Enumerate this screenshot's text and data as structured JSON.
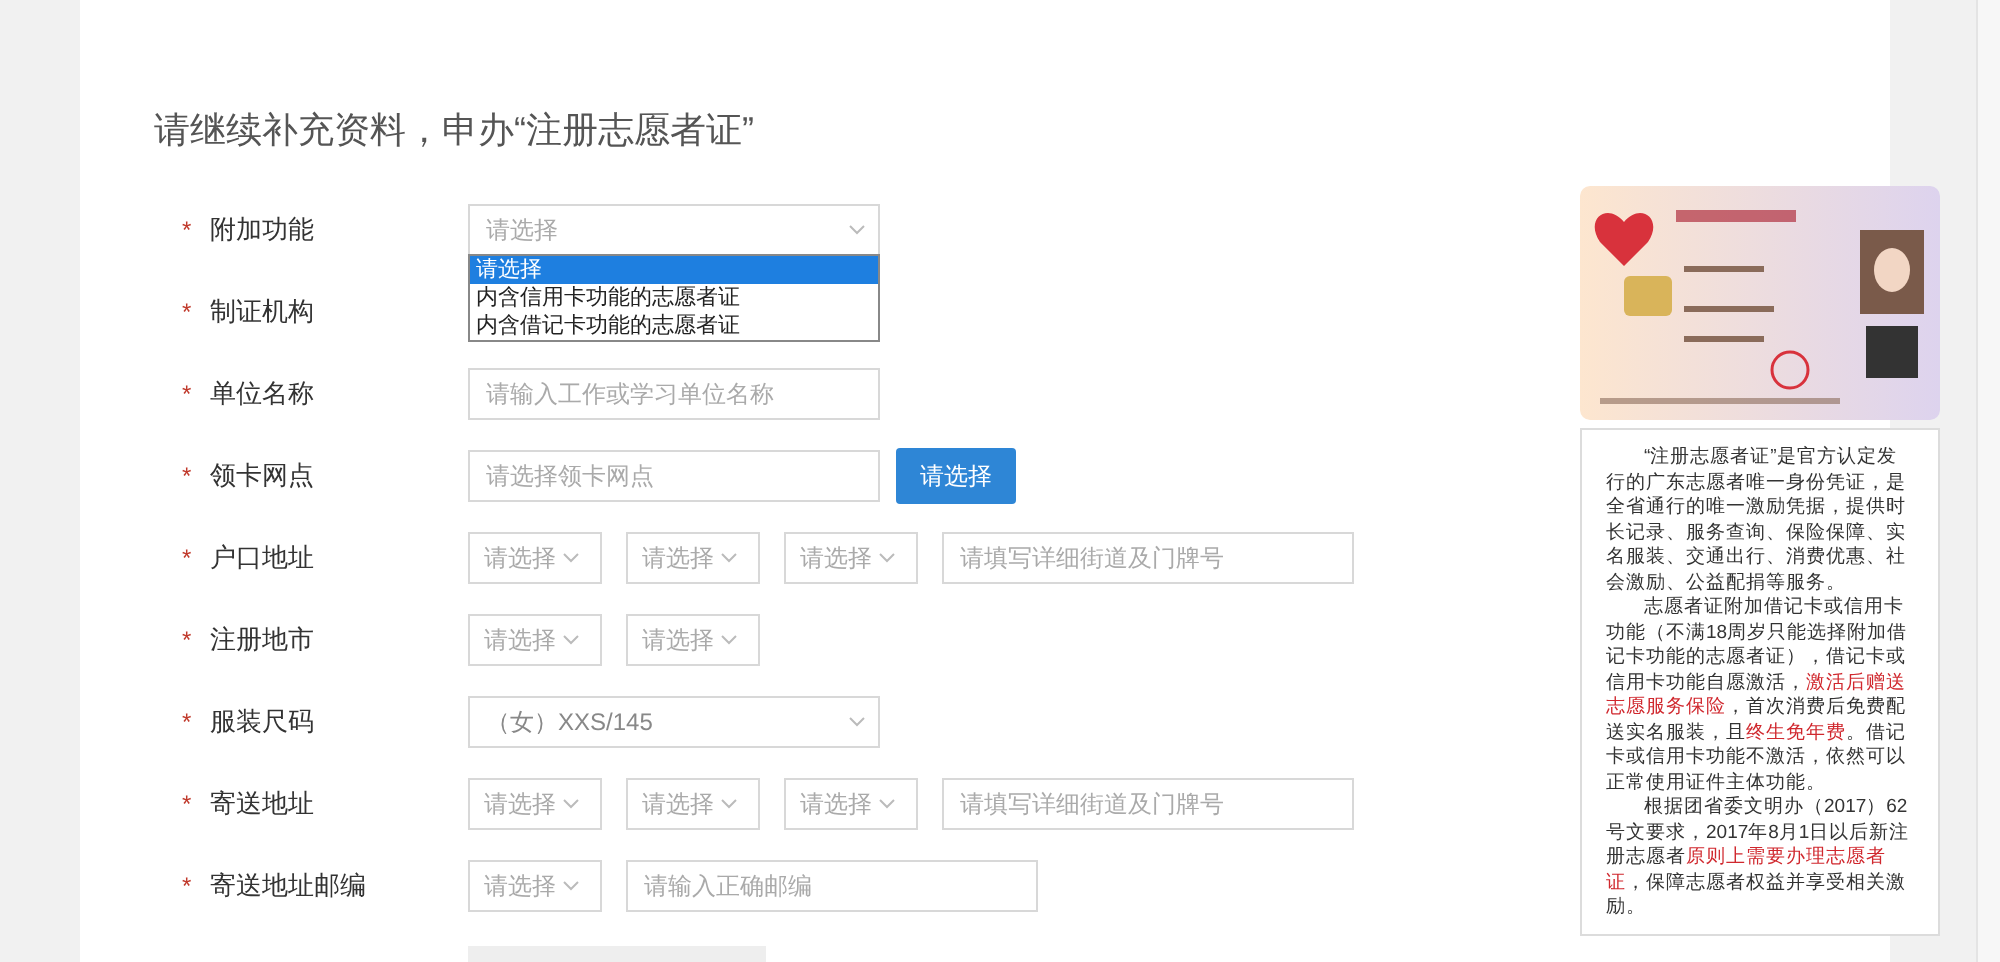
{
  "title": "请继续补充资料，申办“注册志愿者证”",
  "fields": [
    {
      "mark": "*",
      "label": "附加功能",
      "controls": [
        {
          "kind": "select_wide",
          "placeholder": "请选择",
          "expanded": true,
          "options": [
            {
              "label": "请选择",
              "selected": true
            },
            {
              "label": "内含信用卡功能的志愿者证",
              "selected": false
            },
            {
              "label": "内含借记卡功能的志愿者证",
              "selected": false
            }
          ]
        }
      ]
    },
    {
      "mark": "*",
      "label": "制证机构"
    },
    {
      "mark": "*",
      "label": "单位名称",
      "controls": [
        {
          "kind": "input_wide",
          "placeholder": "请输入工作或学习单位名称"
        }
      ]
    },
    {
      "mark": "*",
      "label": "领卡网点",
      "controls": [
        {
          "kind": "input_wide",
          "placeholder": "请选择领卡网点"
        },
        {
          "kind": "button",
          "label": "请选择"
        }
      ]
    },
    {
      "mark": "*",
      "label": "户口地址",
      "controls": [
        {
          "kind": "select_small",
          "placeholder": "请选择"
        },
        {
          "kind": "select_small",
          "placeholder": "请选择"
        },
        {
          "kind": "select_small",
          "placeholder": "请选择"
        },
        {
          "kind": "input_wide",
          "placeholder": "请填写详细街道及门牌号"
        }
      ]
    },
    {
      "mark": "*",
      "label": "注册地市",
      "controls": [
        {
          "kind": "select_small",
          "placeholder": "请选择"
        },
        {
          "kind": "select_small",
          "placeholder": "请选择"
        }
      ]
    },
    {
      "mark": "*",
      "label": "服装尺码",
      "controls": [
        {
          "kind": "select_wide",
          "value": "（女）XXS/145"
        }
      ]
    },
    {
      "mark": "*",
      "label": "寄送地址",
      "controls": [
        {
          "kind": "select_small",
          "placeholder": "请选择"
        },
        {
          "kind": "select_small",
          "placeholder": "请选择"
        },
        {
          "kind": "select_small",
          "placeholder": "请选择"
        },
        {
          "kind": "input_wide",
          "placeholder": "请填写详细街道及门牌号"
        }
      ]
    },
    {
      "mark": "*",
      "label": "寄送地址邮编",
      "controls": [
        {
          "kind": "select_small",
          "placeholder": "请选择"
        },
        {
          "kind": "input_wide",
          "placeholder": "请输入正确邮编"
        }
      ]
    }
  ],
  "info": {
    "card_image": {
      "kind": "picture"
    },
    "paragraphs": [
      [
        {
          "text": "“注册志愿者证”是官方认定发行的广东志愿者唯一身份凭证，是全省通行的唯一激励凭据，提供时长记录、服务查询、保险保障、实名服装、交通出行、消费优惠、社会激励、公益配捐等服务。",
          "highlight": false
        }
      ],
      [
        {
          "text": "志愿者证附加借记卡或信用卡功能（不满18周岁只能选择附加借记卡功能的志愿者证），借记卡或信用卡功能自愿激活，",
          "highlight": false
        },
        {
          "text": "激活后赠送志愿服务保险",
          "highlight": true
        },
        {
          "text": "，首次消费后免费配送实名服装，且",
          "highlight": false
        },
        {
          "text": "终生免年费",
          "highlight": true
        },
        {
          "text": "。借记卡或信用卡功能不激活，依然可以正常使用证件主体功能。",
          "highlight": false
        }
      ],
      [
        {
          "text": "根据团省委文明办（2017）62号文要求，2017年8月1日以后新注册志愿者",
          "highlight": false
        },
        {
          "text": "原则上需要办理志愿者证",
          "highlight": true
        },
        {
          "text": "，保障志愿者权益并享受相关激励。",
          "highlight": false
        }
      ]
    ]
  }
}
